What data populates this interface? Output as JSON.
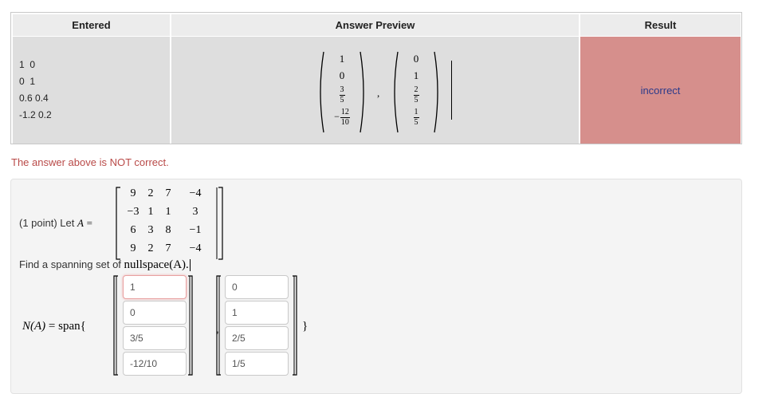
{
  "results_table": {
    "headers": {
      "entered": "Entered",
      "preview": "Answer Preview",
      "result": "Result"
    },
    "entered_lines": [
      "1  0",
      "0  1",
      "0.6 0.4",
      "-1.2 0.2"
    ],
    "preview_vectors": [
      {
        "entries": [
          "1",
          "0",
          "3/5",
          "-12/10"
        ]
      },
      {
        "entries": [
          "0",
          "1",
          "2/5",
          "1/5"
        ]
      }
    ],
    "result": "incorrect",
    "result_color": "#d68f8c"
  },
  "notice": "The answer above is NOT correct.",
  "problem": {
    "intro": "(1 point) Let",
    "matrix_name": "A",
    "equals": "=",
    "matrix_A": [
      [
        "9",
        "2",
        "7",
        "−4"
      ],
      [
        "−3",
        "1",
        "1",
        "3"
      ],
      [
        "6",
        "3",
        "8",
        "−1"
      ],
      [
        "9",
        "2",
        "7",
        "−4"
      ]
    ],
    "find_text": "Find a spanning set of",
    "find_math": "nullspace(A).",
    "span_label_lhs": "N(A)",
    "span_label_rhs": "= span{",
    "close_brace": "}",
    "answer_vectors": [
      [
        "1",
        "0",
        "3/5",
        "-12/10"
      ],
      [
        "0",
        "1",
        "2/5",
        "1/5"
      ]
    ],
    "separator": ","
  }
}
